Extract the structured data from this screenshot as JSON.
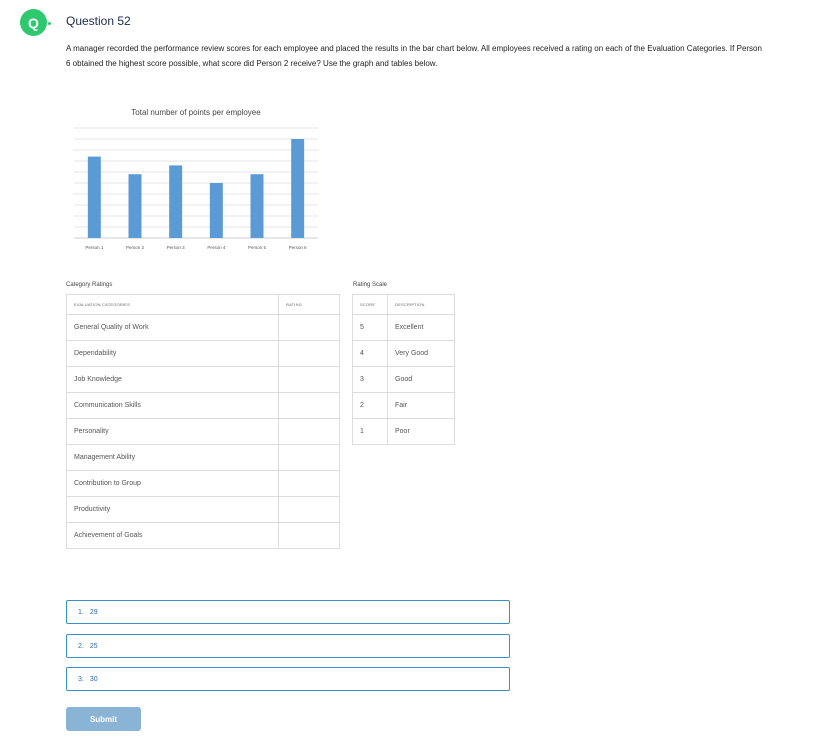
{
  "question": {
    "badge_letter": "Q",
    "title": "Question 52",
    "text": "A manager recorded the performance review scores for each employee and placed the results in the bar chart below. All employees received a rating on each of the Evaluation Categories. If Person 6 obtained the highest score possible, what score did Person 2 receive? Use the graph and tables below."
  },
  "chart_data": {
    "type": "bar",
    "title": "Total number of points per employee",
    "categories": [
      "Person 1",
      "Person 2",
      "Person 3",
      "Person 4",
      "Person 5",
      "Person 6"
    ],
    "values": [
      37,
      29,
      33,
      25,
      29,
      45
    ],
    "ylim": [
      0,
      50
    ],
    "grid": true,
    "color": "#5b9bd5"
  },
  "category_ratings": {
    "label": "Category Ratings",
    "headers": [
      "EVALUATION CATEGORIES",
      "RATING"
    ],
    "rows": [
      "General Quality of Work",
      "Dependability",
      "Job Knowledge",
      "Communication Skills",
      "Personality",
      "Management Ability",
      "Contribution to Group",
      "Productivity",
      "Achievement of Goals"
    ]
  },
  "rating_scale": {
    "label": "Rating Scale",
    "headers": [
      "SCORE",
      "DESCRIPTION"
    ],
    "rows": [
      {
        "score": "5",
        "description": "Excellent"
      },
      {
        "score": "4",
        "description": "Very Good"
      },
      {
        "score": "3",
        "description": "Good"
      },
      {
        "score": "2",
        "description": "Fair"
      },
      {
        "score": "1",
        "description": "Poor"
      }
    ]
  },
  "answers": [
    {
      "number": "1.",
      "value": "29"
    },
    {
      "number": "2.",
      "value": "25"
    },
    {
      "number": "3.",
      "value": "30"
    }
  ],
  "submit_label": "Submit"
}
